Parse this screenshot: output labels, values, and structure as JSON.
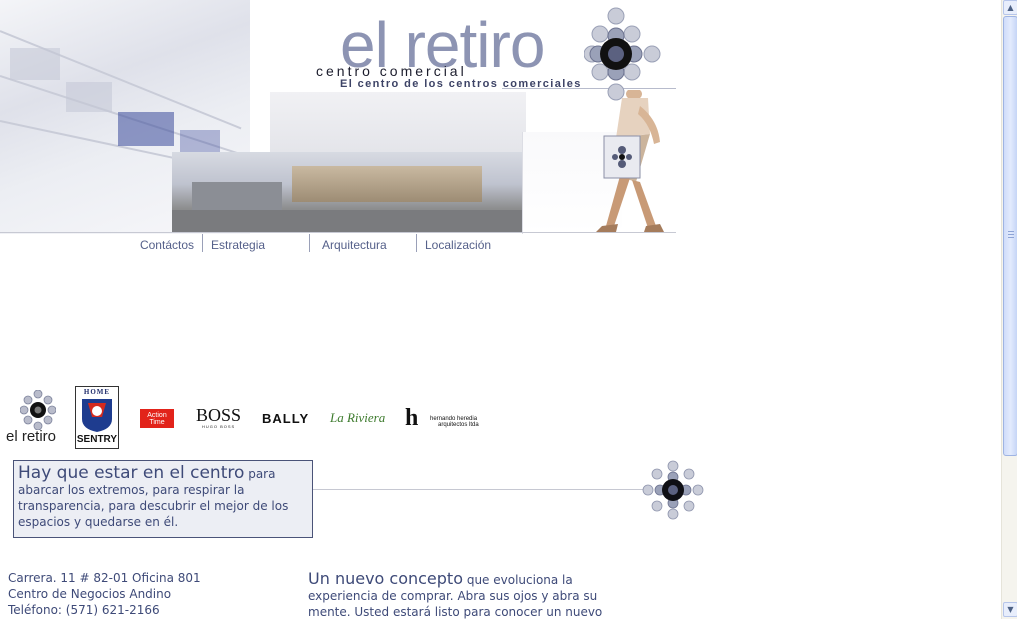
{
  "header": {
    "logo_title": "el retiro",
    "logo_subtitle": "centro comercial",
    "logo_tagline": "El centro de los centros comerciales"
  },
  "nav": {
    "items": [
      {
        "label": "Contáctos"
      },
      {
        "label": "Estrategia"
      },
      {
        "label": "Arquitectura"
      },
      {
        "label": "Localización"
      }
    ]
  },
  "sponsors": {
    "el_retiro_logo": "el retiro",
    "home_sentry_top": "HOME",
    "home_sentry_bottom": "SENTRY",
    "action_time": "Action Time",
    "boss": "BOSS",
    "boss_sub": "HUGO BOSS",
    "bally": "BALLY",
    "la_riviera": "La Riviera",
    "hernando_line1": "hernando heredia",
    "hernando_line2": "arquitectos ltda"
  },
  "tagline": {
    "headline": "Hay que estar en el centro",
    "body": "para abarcar los extremos, para respirar la transparencia, para descubrir el mejor de los espacios y quedarse en él."
  },
  "address": {
    "line1": "Carrera. 11 # 82-01 Oficina 801",
    "line2": "Centro de Negocios Andino",
    "line3": "Teléfono: (571) 621-2166"
  },
  "concept": {
    "headline": "Un nuevo concepto",
    "body": "que evoluciona la experiencia de comprar. Abra sus ojos y abra su mente. Usted estará listo para conocer un nuevo"
  },
  "colors": {
    "brand_blue": "#3e4a78",
    "logo_gray_blue": "#8d94b3",
    "action_time_red": "#e2231a",
    "riviera_green": "#3c7a2c"
  }
}
